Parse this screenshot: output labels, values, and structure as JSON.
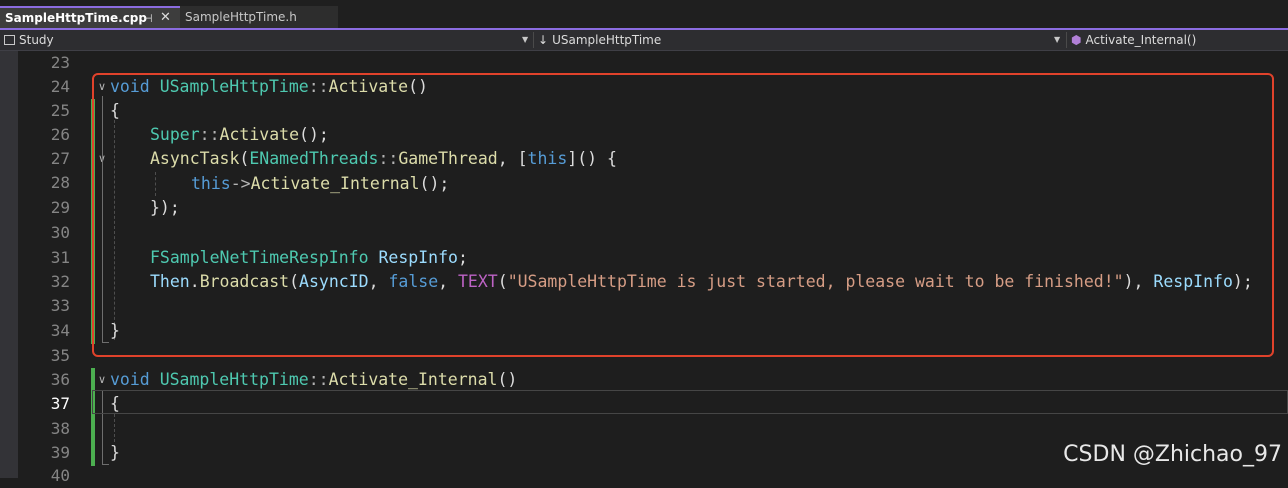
{
  "tabs": [
    {
      "label": "SampleHttpTime.cpp",
      "active": true,
      "pin_icon": "pin-icon",
      "close_icon": "close-icon"
    },
    {
      "label": "SampleHttpTime.h",
      "active": false
    }
  ],
  "navbar": {
    "project": "Study",
    "class_scope": "USampleHttpTime",
    "member": "Activate_Internal()"
  },
  "gutter": {
    "line_numbers": [
      "23",
      "24",
      "25",
      "26",
      "27",
      "28",
      "29",
      "30",
      "31",
      "32",
      "33",
      "34",
      "35",
      "36",
      "37",
      "38",
      "39",
      "40"
    ],
    "current_line": "37"
  },
  "code_tokens": {
    "l24": [
      "void",
      "USampleHttpTime",
      "::",
      "Activate",
      "()"
    ],
    "l25": [
      "{"
    ],
    "l26": [
      "Super",
      "::",
      "Activate",
      "();"
    ],
    "l27": [
      "AsyncTask",
      "(",
      "ENamedThreads",
      "::",
      "GameThread",
      ", [",
      "this",
      "]() {"
    ],
    "l28": [
      "this",
      "->",
      "Activate_Internal",
      "();"
    ],
    "l29": [
      "});"
    ],
    "l31": [
      "FSampleNetTimeRespInfo",
      "RespInfo",
      ";"
    ],
    "l32": [
      "Then",
      ".",
      "Broadcast",
      "(",
      "AsyncID",
      ", ",
      "false",
      ", ",
      "TEXT",
      "(",
      "\"USampleHttpTime is just started, please wait to be finished!\"",
      "), ",
      "RespInfo",
      ");"
    ],
    "l34": [
      "}"
    ],
    "l36": [
      "void",
      "USampleHttpTime",
      "::",
      "Activate_Internal",
      "()"
    ],
    "l37": [
      "{"
    ],
    "l39": [
      "}"
    ]
  },
  "annotation": {
    "highlight_color": "#e0422b"
  },
  "watermark": "CSDN @Zhichao_97",
  "colors": {
    "accent": "#8b6ce0",
    "change_bar": "#4caf50",
    "keyword": "#569cd6",
    "type": "#4ec9b0",
    "function": "#dcdcaa",
    "string": "#d69d85"
  }
}
